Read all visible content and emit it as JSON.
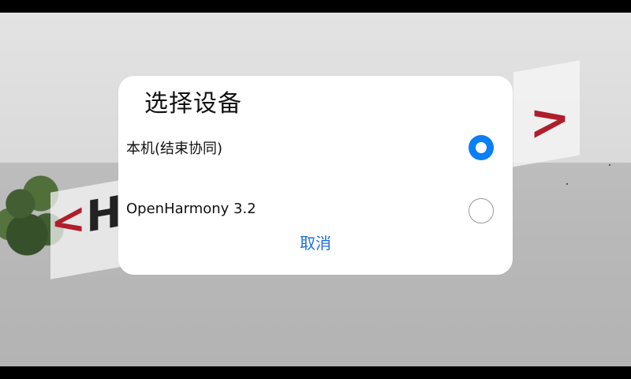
{
  "dialog": {
    "title": "选择设备",
    "options": [
      {
        "label": "本机(结束协同)",
        "selected": true
      },
      {
        "label": "OpenHarmony 3.2",
        "selected": false
      }
    ],
    "cancel_label": "取消"
  },
  "colors": {
    "accent": "#0A7FF6",
    "cancel_text": "#1F6ED6",
    "sign_red": "#B01D2B"
  },
  "background": {
    "sign_left_text": "<H",
    "sign_right_text": ">"
  }
}
